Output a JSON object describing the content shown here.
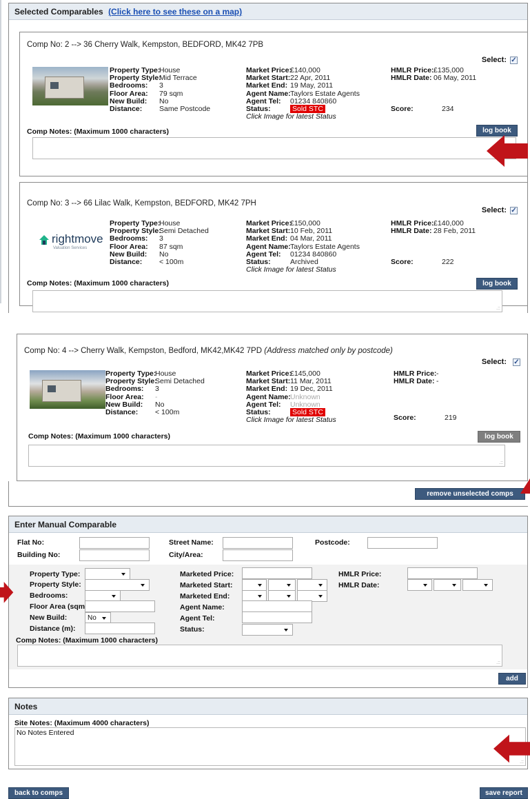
{
  "selected_comparables": {
    "title": "Selected Comparables",
    "map_link": "(Click here to see these on a map)"
  },
  "comps": [
    {
      "heading": "Comp No: 2 --> 36 Cherry Walk, Kempston, BEDFORD, MK42 7PB",
      "heading_note": "",
      "select_label": "Select:",
      "left": [
        {
          "k": "Property Type:",
          "v": "House"
        },
        {
          "k": "Property Style:",
          "v": "Mid Terrace"
        },
        {
          "k": "Bedrooms:",
          "v": "3"
        },
        {
          "k": "Floor Area:",
          "v": "79 sqm"
        },
        {
          "k": "New Build:",
          "v": "No"
        },
        {
          "k": "Distance:",
          "v": "Same Postcode"
        }
      ],
      "mid": [
        {
          "k": "Market Price:",
          "v": "£140,000"
        },
        {
          "k": "Market Start:",
          "v": "22 Apr, 2011"
        },
        {
          "k": "Market End:",
          "v": "19 May, 2011"
        },
        {
          "k": "Agent Name:",
          "v": "Taylors Estate Agents"
        },
        {
          "k": "Agent Tel:",
          "v": "01234 840860"
        },
        {
          "k": "Status:",
          "v": "Sold STC"
        }
      ],
      "click_note": "Click Image for latest Status",
      "right": [
        {
          "k": "HMLR Price:",
          "v": "£135,000"
        },
        {
          "k": "HMLR Date:",
          "v": "06 May, 2011"
        }
      ],
      "score_label": "Score:",
      "score": "234",
      "notes_label": "Comp Notes: (Maximum 1000 characters)",
      "logbook": "log book"
    },
    {
      "heading": "Comp No: 3 --> 66 Lilac Walk, Kempston, BEDFORD, MK42 7PH",
      "heading_note": "",
      "select_label": "Select:",
      "logo_text": "rightmove",
      "logo_sub": "Valuation Services",
      "left": [
        {
          "k": "Property Type:",
          "v": "House"
        },
        {
          "k": "Property Style:",
          "v": "Semi Detached"
        },
        {
          "k": "Bedrooms:",
          "v": "3"
        },
        {
          "k": "Floor Area:",
          "v": "87 sqm"
        },
        {
          "k": "New Build:",
          "v": "No"
        },
        {
          "k": "Distance:",
          "v": "< 100m"
        }
      ],
      "mid": [
        {
          "k": "Market Price:",
          "v": "£150,000"
        },
        {
          "k": "Market Start:",
          "v": "10 Feb, 2011"
        },
        {
          "k": "Market End:",
          "v": "04 Mar, 2011"
        },
        {
          "k": "Agent Name:",
          "v": "Taylors Estate Agents"
        },
        {
          "k": "Agent Tel:",
          "v": "01234 840860"
        },
        {
          "k": "Status:",
          "v": "Archived"
        }
      ],
      "click_note": "Click Image for latest Status",
      "right": [
        {
          "k": "HMLR Price:",
          "v": "£140,000"
        },
        {
          "k": "HMLR Date:",
          "v": "28 Feb, 2011"
        }
      ],
      "score_label": "Score:",
      "score": "222",
      "notes_label": "Comp Notes: (Maximum 1000 characters)",
      "logbook": "log book"
    },
    {
      "heading": "Comp No: 4 --> Cherry Walk, Kempston, Bedford, MK42,MK42 7PD",
      "heading_note": "(Address matched only by postcode)",
      "select_label": "Select:",
      "left": [
        {
          "k": "Property Type:",
          "v": "House"
        },
        {
          "k": "Property Style:",
          "v": "Semi Detached"
        },
        {
          "k": "Bedrooms:",
          "v": "3"
        },
        {
          "k": "Floor Area:",
          "v": "-"
        },
        {
          "k": "New Build:",
          "v": "No"
        },
        {
          "k": "Distance:",
          "v": "< 100m"
        }
      ],
      "mid": [
        {
          "k": "Market Price:",
          "v": "£145,000"
        },
        {
          "k": "Market Start:",
          "v": "11 Mar, 2011"
        },
        {
          "k": "Market End:",
          "v": "19 Dec, 2011"
        },
        {
          "k": "Agent Name:",
          "v": "Unknown"
        },
        {
          "k": "Agent Tel:",
          "v": "Unknown"
        },
        {
          "k": "Status:",
          "v": "Sold STC"
        }
      ],
      "click_note": "Click Image for latest Status",
      "right": [
        {
          "k": "HMLR Price:",
          "v": "-"
        },
        {
          "k": "HMLR Date:",
          "v": "-"
        }
      ],
      "score_label": "Score:",
      "score": "219",
      "notes_label": "Comp Notes: (Maximum 1000 characters)",
      "logbook": "log book"
    }
  ],
  "remove_button": "remove unselected comps",
  "manual": {
    "title": "Enter Manual Comparable",
    "flat_no": "Flat No:",
    "building_no": "Building No:",
    "street_name": "Street Name:",
    "city_area": "City/Area:",
    "postcode": "Postcode:",
    "property_type": "Property Type:",
    "property_style": "Property Style:",
    "bedrooms": "Bedrooms:",
    "floor_area": "Floor Area (sqm):",
    "new_build": "New Build:",
    "new_build_value": "No",
    "distance": "Distance (m):",
    "marketed_price": "Marketed Price:",
    "marketed_start": "Marketed Start:",
    "marketed_end": "Marketed End:",
    "agent_name": "Agent Name:",
    "agent_tel": "Agent Tel:",
    "status": "Status:",
    "hmlr_price": "HMLR Price:",
    "hmlr_date": "HMLR Date:",
    "notes_label": "Comp Notes: (Maximum 1000 characters)",
    "add": "add"
  },
  "notes": {
    "title": "Notes",
    "site_label": "Site Notes: (Maximum 4000 characters)",
    "site_value": "No Notes Entered"
  },
  "footer": {
    "back": "back to comps",
    "save": "save report"
  },
  "colors": {
    "button": "#3d5a7e",
    "arrow": "#c0141a",
    "status_red": "#e00000"
  }
}
